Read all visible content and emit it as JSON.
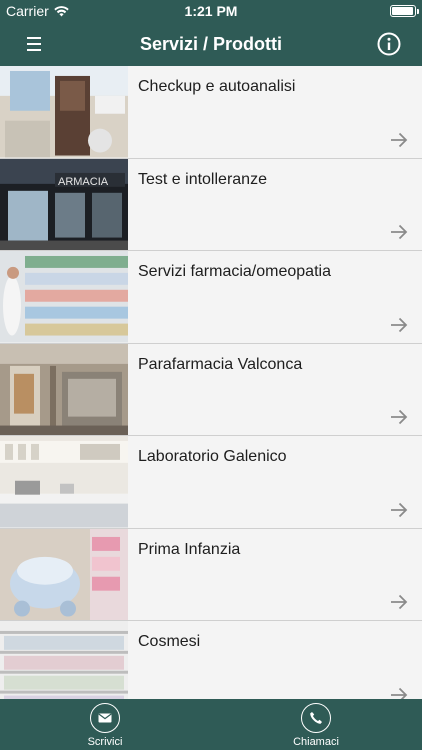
{
  "status_bar": {
    "carrier": "Carrier",
    "time": "1:21 PM",
    "battery_level": 0.95
  },
  "nav": {
    "title": "Servizi / Prodotti",
    "menu_icon": "hamburger-menu-icon",
    "info_icon": "info-icon"
  },
  "items": [
    {
      "label": "Checkup e autoanalisi",
      "image": "checkup-photo"
    },
    {
      "label": "Test e intolleranze",
      "image": "pharmacy-storefront-photo"
    },
    {
      "label": "Servizi farmacia/omeopatia",
      "image": "pharmacy-shelves-photo"
    },
    {
      "label": "Parafarmacia Valconca",
      "image": "parafarmacia-storefront-photo"
    },
    {
      "label": "Laboratorio Galenico",
      "image": "laboratory-photo"
    },
    {
      "label": "Prima Infanzia",
      "image": "baby-products-photo"
    },
    {
      "label": "Cosmesi",
      "image": "cosmetics-shelves-photo"
    }
  ],
  "tabbar": {
    "write": {
      "label": "Scrivici",
      "icon": "envelope-icon"
    },
    "call": {
      "label": "Chiamaci",
      "icon": "phone-icon"
    }
  },
  "colors": {
    "bar": "#2f5b56",
    "row_bg": "#f4f4f4",
    "divider": "#cfcfcf"
  }
}
